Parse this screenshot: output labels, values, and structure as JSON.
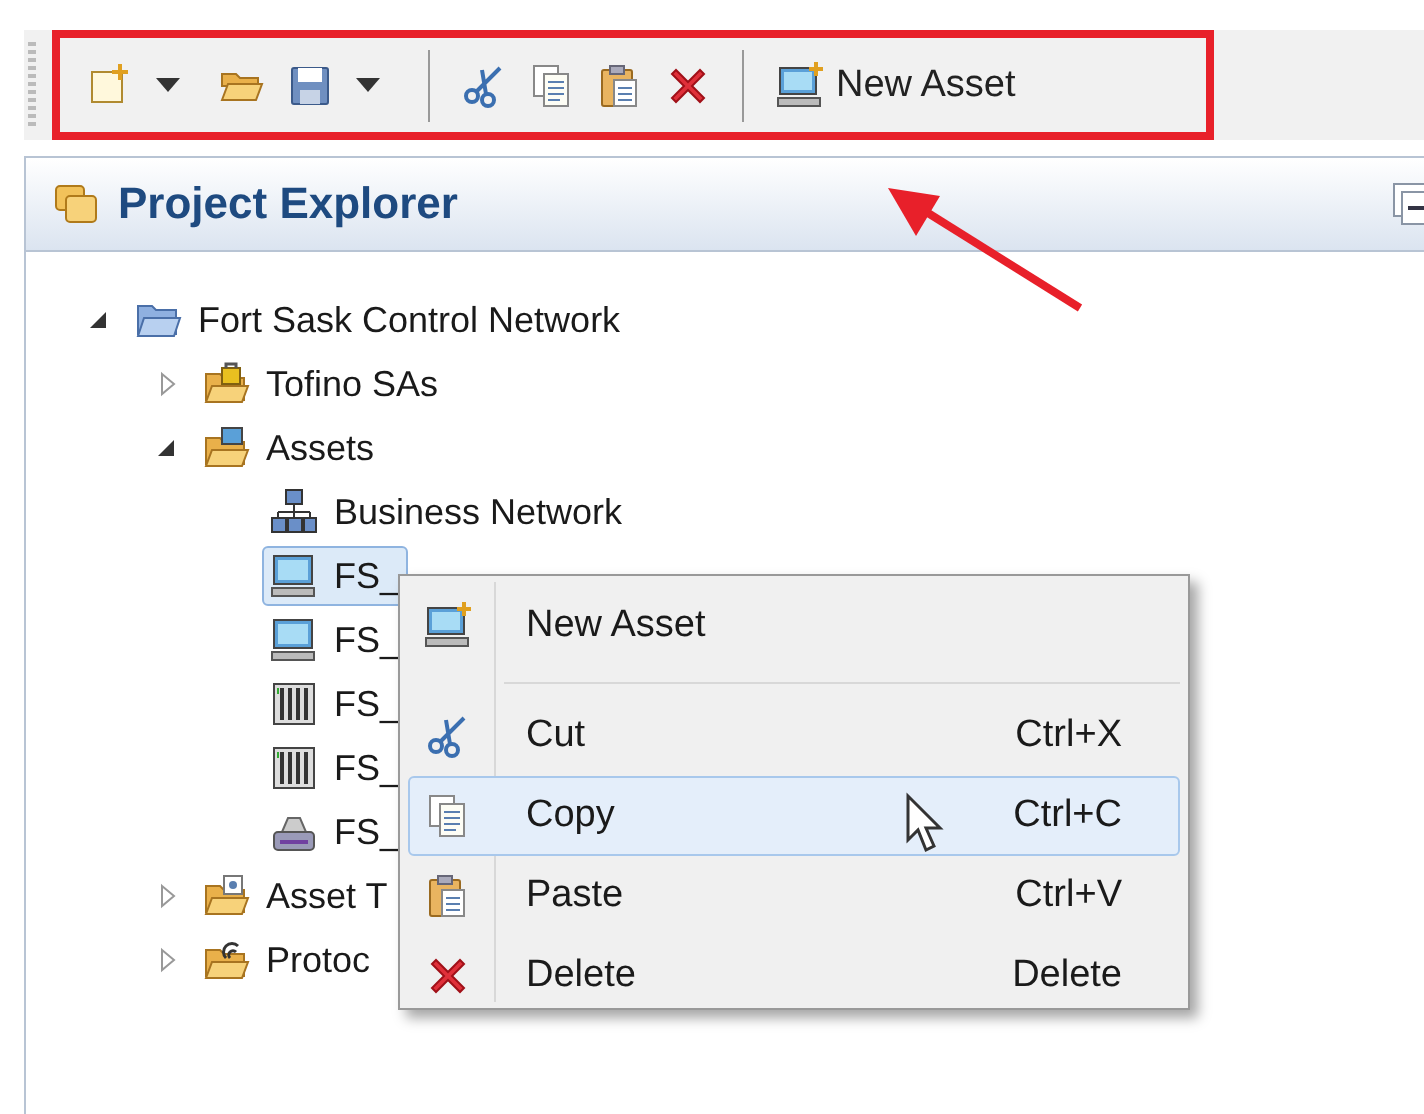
{
  "toolbar": {
    "items": [
      {
        "kind": "new"
      },
      {
        "kind": "dropdown"
      },
      {
        "kind": "open"
      },
      {
        "kind": "save"
      },
      {
        "kind": "dropdown"
      },
      {
        "kind": "separator"
      },
      {
        "kind": "cut"
      },
      {
        "kind": "copy"
      },
      {
        "kind": "paste"
      },
      {
        "kind": "delete"
      },
      {
        "kind": "separator"
      },
      {
        "kind": "new-asset",
        "label": "New Asset"
      }
    ]
  },
  "panel": {
    "title": "Project Explorer"
  },
  "tree": [
    {
      "label": "Fort Sask Control Network",
      "kind": "folder",
      "expanded": true,
      "selected": false,
      "children": [
        {
          "label": "Tofino SAs",
          "kind": "lock-folder",
          "expanded": false,
          "selected": false
        },
        {
          "label": "Assets",
          "kind": "asset-folder",
          "expanded": true,
          "selected": false,
          "children": [
            {
              "label": "Business Network",
              "kind": "network",
              "selected": false
            },
            {
              "label": "FS_",
              "kind": "workstation",
              "selected": true
            },
            {
              "label": "FS_",
              "kind": "workstation",
              "selected": false
            },
            {
              "label": "FS_",
              "kind": "controller",
              "selected": false
            },
            {
              "label": "FS_",
              "kind": "controller",
              "selected": false
            },
            {
              "label": "FS_",
              "kind": "device",
              "selected": false
            }
          ]
        },
        {
          "label": "Asset T",
          "kind": "template-folder",
          "expanded": false,
          "selected": false
        },
        {
          "label": "Protoc",
          "kind": "protocol-folder",
          "expanded": false,
          "selected": false
        }
      ]
    }
  ],
  "context_menu": {
    "items": [
      {
        "kind": "new-asset",
        "label": "New Asset",
        "selected": false
      },
      {
        "kind": "separator"
      },
      {
        "kind": "cut",
        "label": "Cut",
        "shortcut": "Ctrl+X",
        "selected": false
      },
      {
        "kind": "copy",
        "label": "Copy",
        "shortcut": "Ctrl+C",
        "selected": true
      },
      {
        "kind": "paste",
        "label": "Paste",
        "shortcut": "Ctrl+V",
        "selected": false
      },
      {
        "kind": "delete",
        "label": "Delete",
        "shortcut": "Delete",
        "selected": false
      }
    ]
  }
}
